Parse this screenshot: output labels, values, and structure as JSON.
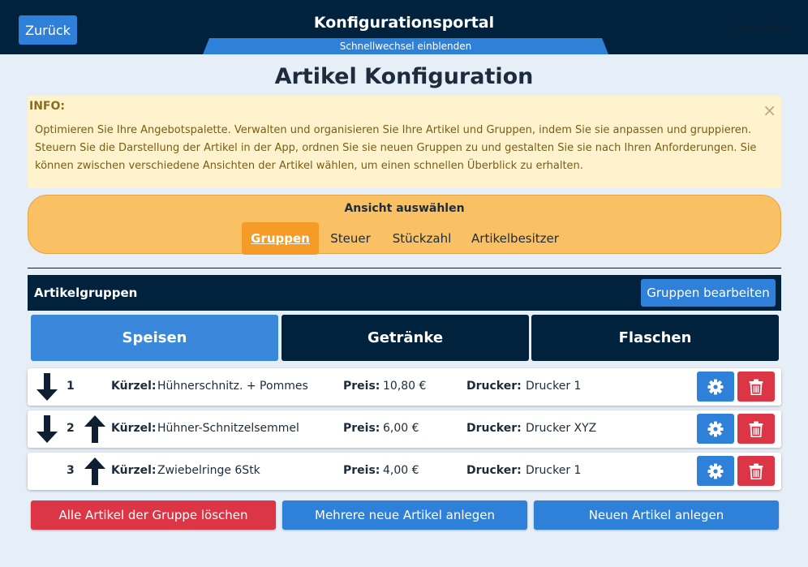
{
  "header": {
    "back_label": "Zurück",
    "title": "Konfigurationsportal",
    "quick_switch_label": "Schnellwechsel einblenden",
    "right_text": "Demomodus"
  },
  "page": {
    "title": "Artikel Konfiguration"
  },
  "info": {
    "title": "INFO:",
    "close": "×",
    "text": "Optimieren Sie Ihre Angebotspalette. Verwalten und organisieren Sie Ihre Artikel und Gruppen, indem Sie sie anpassen und gruppieren. Steuern Sie die Darstellung der Artikel in der App, ordnen Sie sie neuen Gruppen zu und gestalten Sie sie nach Ihren Anforderungen. Sie können zwischen verschiedene Ansichten der Artikel wählen, um einen schnellen Überblick zu erhalten."
  },
  "view": {
    "title": "Ansicht auswählen",
    "tabs": [
      "Gruppen",
      "Steuer",
      "Stückzahl",
      "Artikelbesitzer"
    ]
  },
  "groups": {
    "title": "Artikelgruppen",
    "edit_label": "Gruppen bearbeiten",
    "tabs": [
      "Speisen",
      "Getränke",
      "Flaschen"
    ]
  },
  "labels": {
    "kuerzel": "Kürzel:",
    "preis": "Preis:",
    "drucker": "Drucker:"
  },
  "items": [
    {
      "num": "1",
      "kuerzel": "Hühnerschnitz. + Pommes",
      "preis": "10,80 €",
      "drucker": "Drucker 1"
    },
    {
      "num": "2",
      "kuerzel": "Hühner-Schnitzelsemmel",
      "preis": "6,00 €",
      "drucker": "Drucker XYZ"
    },
    {
      "num": "3",
      "kuerzel": "Zwiebelringe 6Stk",
      "preis": "4,00 €",
      "drucker": "Drucker 1"
    }
  ],
  "bottom": {
    "delete_all": "Alle Artikel der Gruppe löschen",
    "create_many": "Mehrere neue Artikel anlegen",
    "create_one": "Neuen Artikel anlegen"
  },
  "colors": {
    "navy": "#00223d",
    "primary": "#2f80d8",
    "danger": "#dc3545",
    "warning_bg": "#fff3cd",
    "orange": "#f59c28"
  }
}
